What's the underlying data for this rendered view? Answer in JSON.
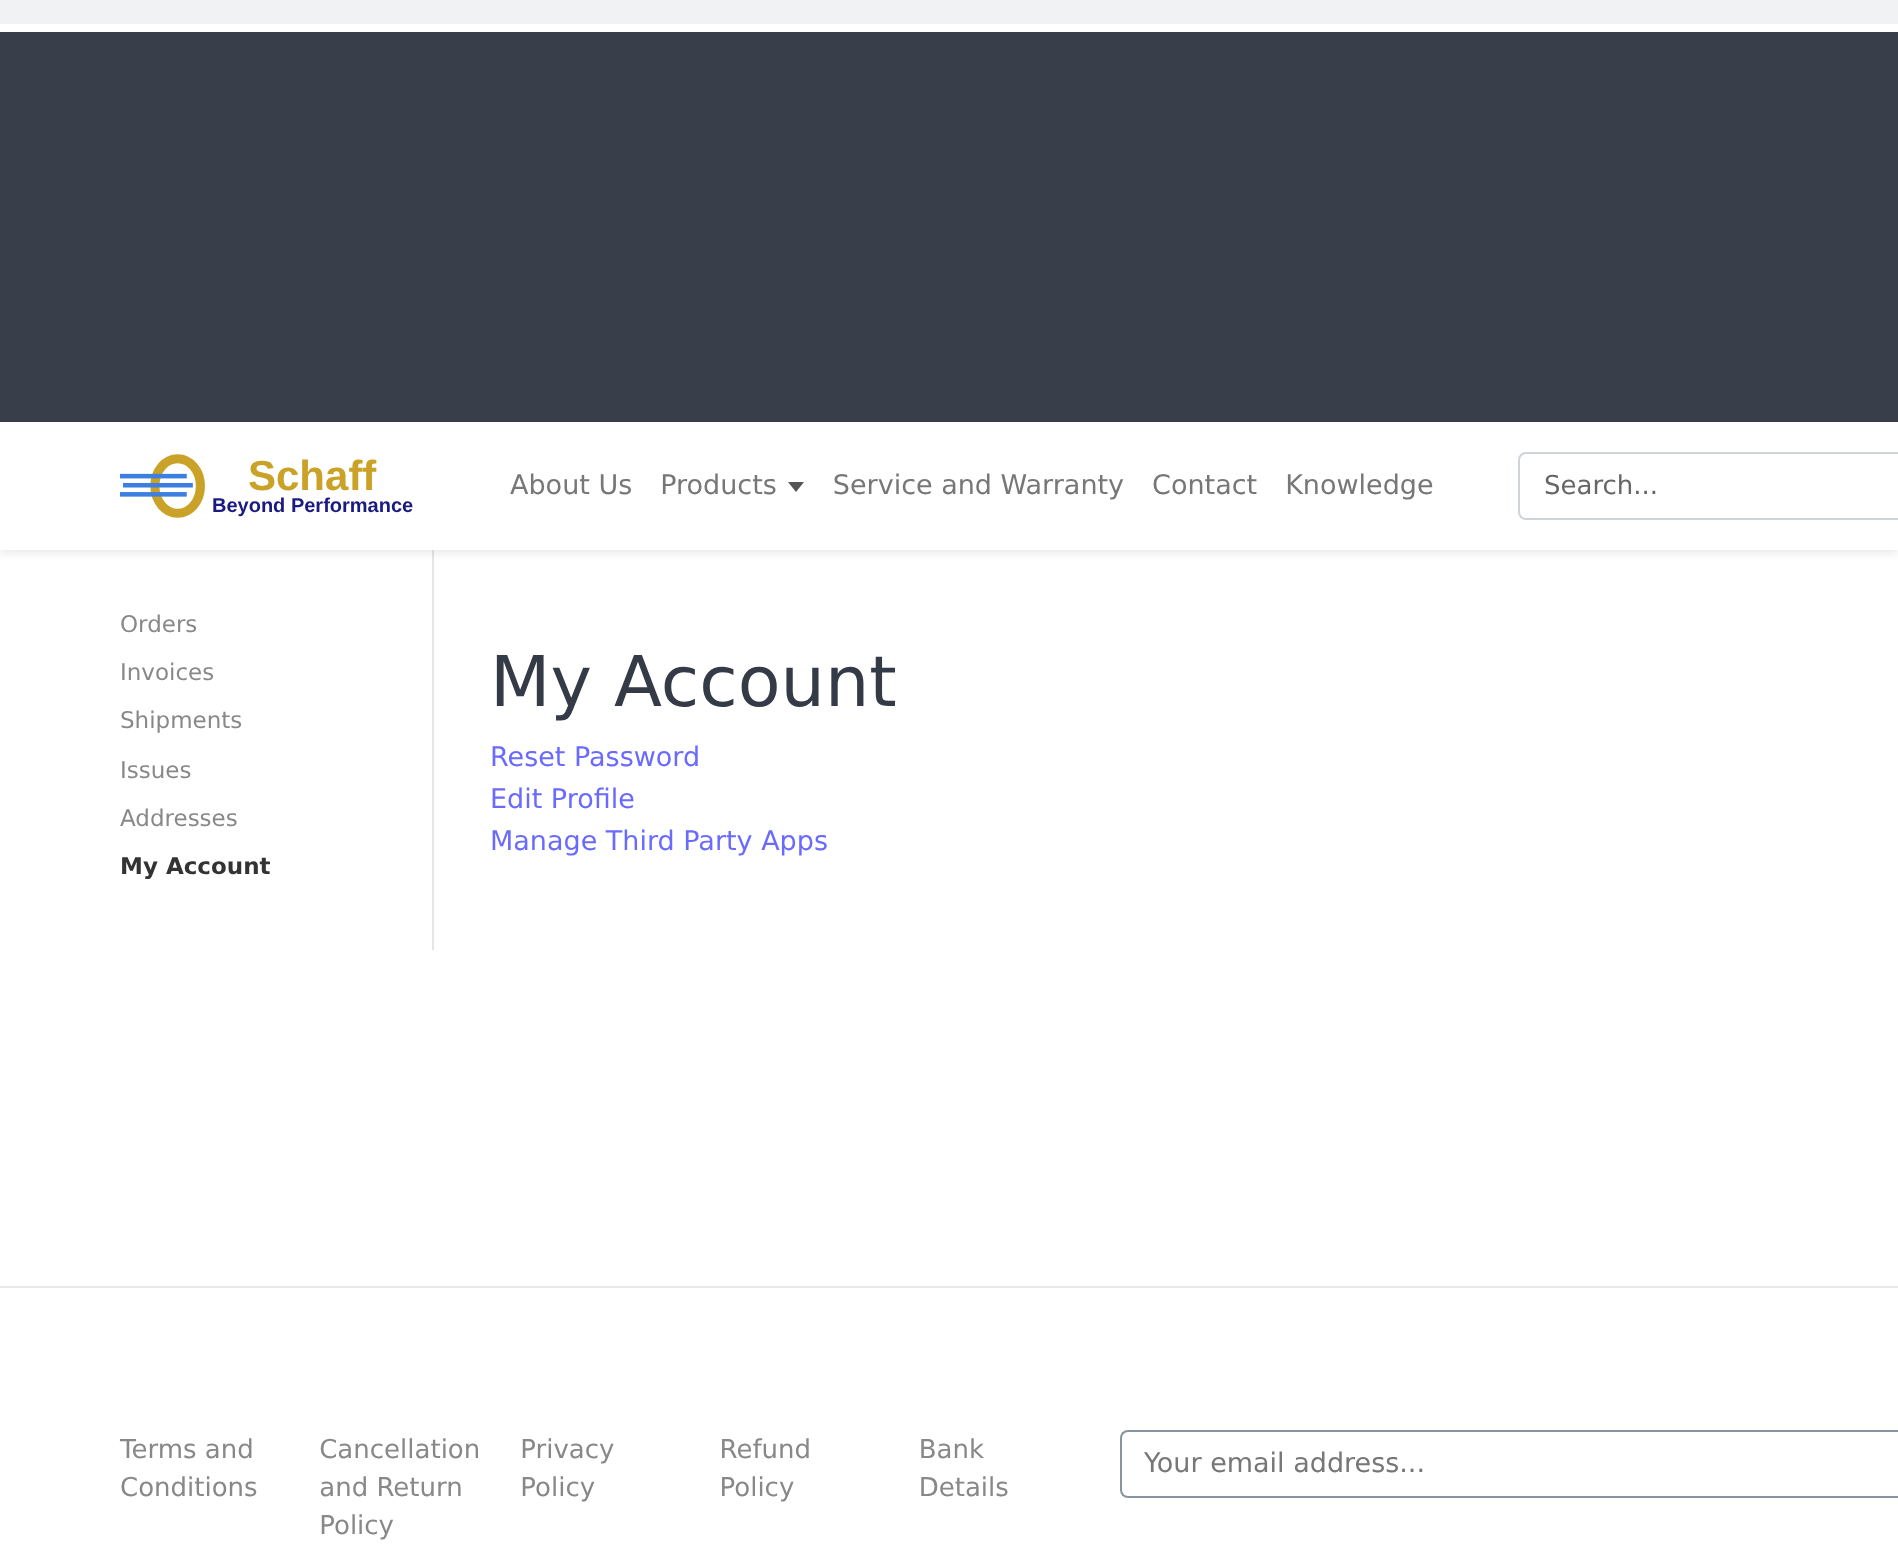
{
  "navbar": {
    "logo": {
      "title": "Schaff",
      "tagline": "Beyond Performance"
    },
    "items": [
      {
        "label": "About Us",
        "kind": "link"
      },
      {
        "label": "Products",
        "kind": "dropdown"
      },
      {
        "label": "Service and Warranty",
        "kind": "link"
      },
      {
        "label": "Contact",
        "kind": "link"
      },
      {
        "label": "Knowledge",
        "kind": "link"
      }
    ],
    "search": {
      "placeholder": "Search..."
    }
  },
  "sidebar": {
    "items": [
      {
        "label": "Orders",
        "selected": false
      },
      {
        "label": "Invoices",
        "selected": false
      },
      {
        "label": "Shipments",
        "selected": false
      },
      {
        "label": "Issues",
        "selected": false
      },
      {
        "label": "Addresses",
        "selected": false
      },
      {
        "label": "My Account",
        "selected": true
      }
    ]
  },
  "main": {
    "title": "My Account",
    "links": [
      "Reset Password",
      "Edit Profile",
      "Manage Third Party Apps"
    ]
  },
  "footer": {
    "links": [
      "Terms and Conditions",
      "Cancellation and Return Policy",
      "Privacy Policy",
      "Refund Policy",
      "Bank Details"
    ],
    "newsletter": {
      "placeholder": "Your email address..."
    }
  }
}
